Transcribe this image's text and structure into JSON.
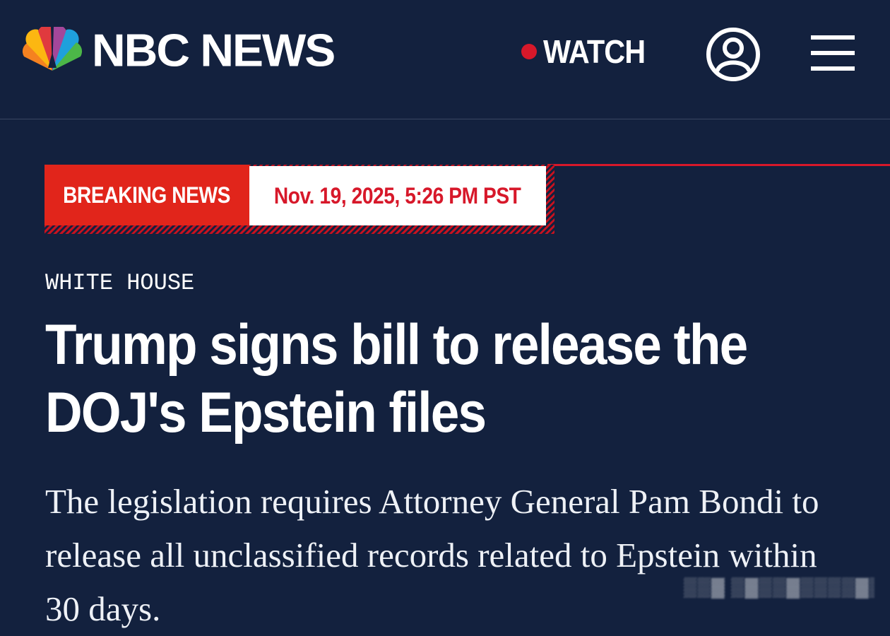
{
  "header": {
    "brand": "NBC NEWS",
    "watch_label": "WATCH",
    "logo_icon": "nbc-peacock-icon",
    "account_icon": "user-account-icon",
    "menu_icon": "hamburger-menu-icon"
  },
  "banner": {
    "label": "BREAKING NEWS",
    "timestamp": "Nov. 19, 2025, 5:26 PM PST"
  },
  "article": {
    "section": "WHITE HOUSE",
    "headline": "Trump signs bill to release the DOJ's Epstein files",
    "dek": "The legislation requires Attorney General Pam Bondi to release all unclassified records related to Epstein within 30 days."
  },
  "colors": {
    "background": "#13213e",
    "accent_red": "#e1251b",
    "text": "#ffffff"
  }
}
